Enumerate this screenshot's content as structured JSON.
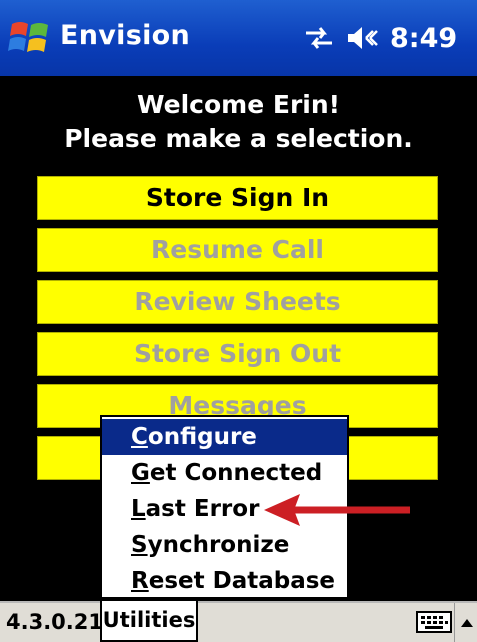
{
  "titlebar": {
    "app_title": "Envision",
    "time": "8:49",
    "icons": [
      "windows-start-icon",
      "connectivity-icon",
      "speaker-icon"
    ]
  },
  "welcome": {
    "line1": "Welcome Erin!",
    "line2": "Please make a selection."
  },
  "buttons": [
    {
      "label": "Store Sign In",
      "enabled": true
    },
    {
      "label": "Resume Call",
      "enabled": false
    },
    {
      "label": "Review Sheets",
      "enabled": false
    },
    {
      "label": "Store Sign Out",
      "enabled": false
    },
    {
      "label": "Messages",
      "enabled": false
    },
    {
      "label": "",
      "enabled": false
    }
  ],
  "popup_menu": {
    "items": [
      {
        "first": "C",
        "rest": "onfigure",
        "selected": true
      },
      {
        "first": "G",
        "rest": "et Connected",
        "selected": false
      },
      {
        "first": "L",
        "rest": "ast Error",
        "selected": false
      },
      {
        "first": "S",
        "rest": "ynchronize",
        "selected": false
      },
      {
        "first": "R",
        "rest": "eset Database",
        "selected": false
      }
    ]
  },
  "menubar": {
    "version": "4.3.0.21",
    "utilities": "Utilities"
  },
  "colors": {
    "titlebar": "#0a3db8",
    "button_bg": "#ffff00",
    "disabled_text": "#a0a0a0",
    "menu_highlight": "#0a2a8a",
    "arrow": "#cc1f24"
  }
}
